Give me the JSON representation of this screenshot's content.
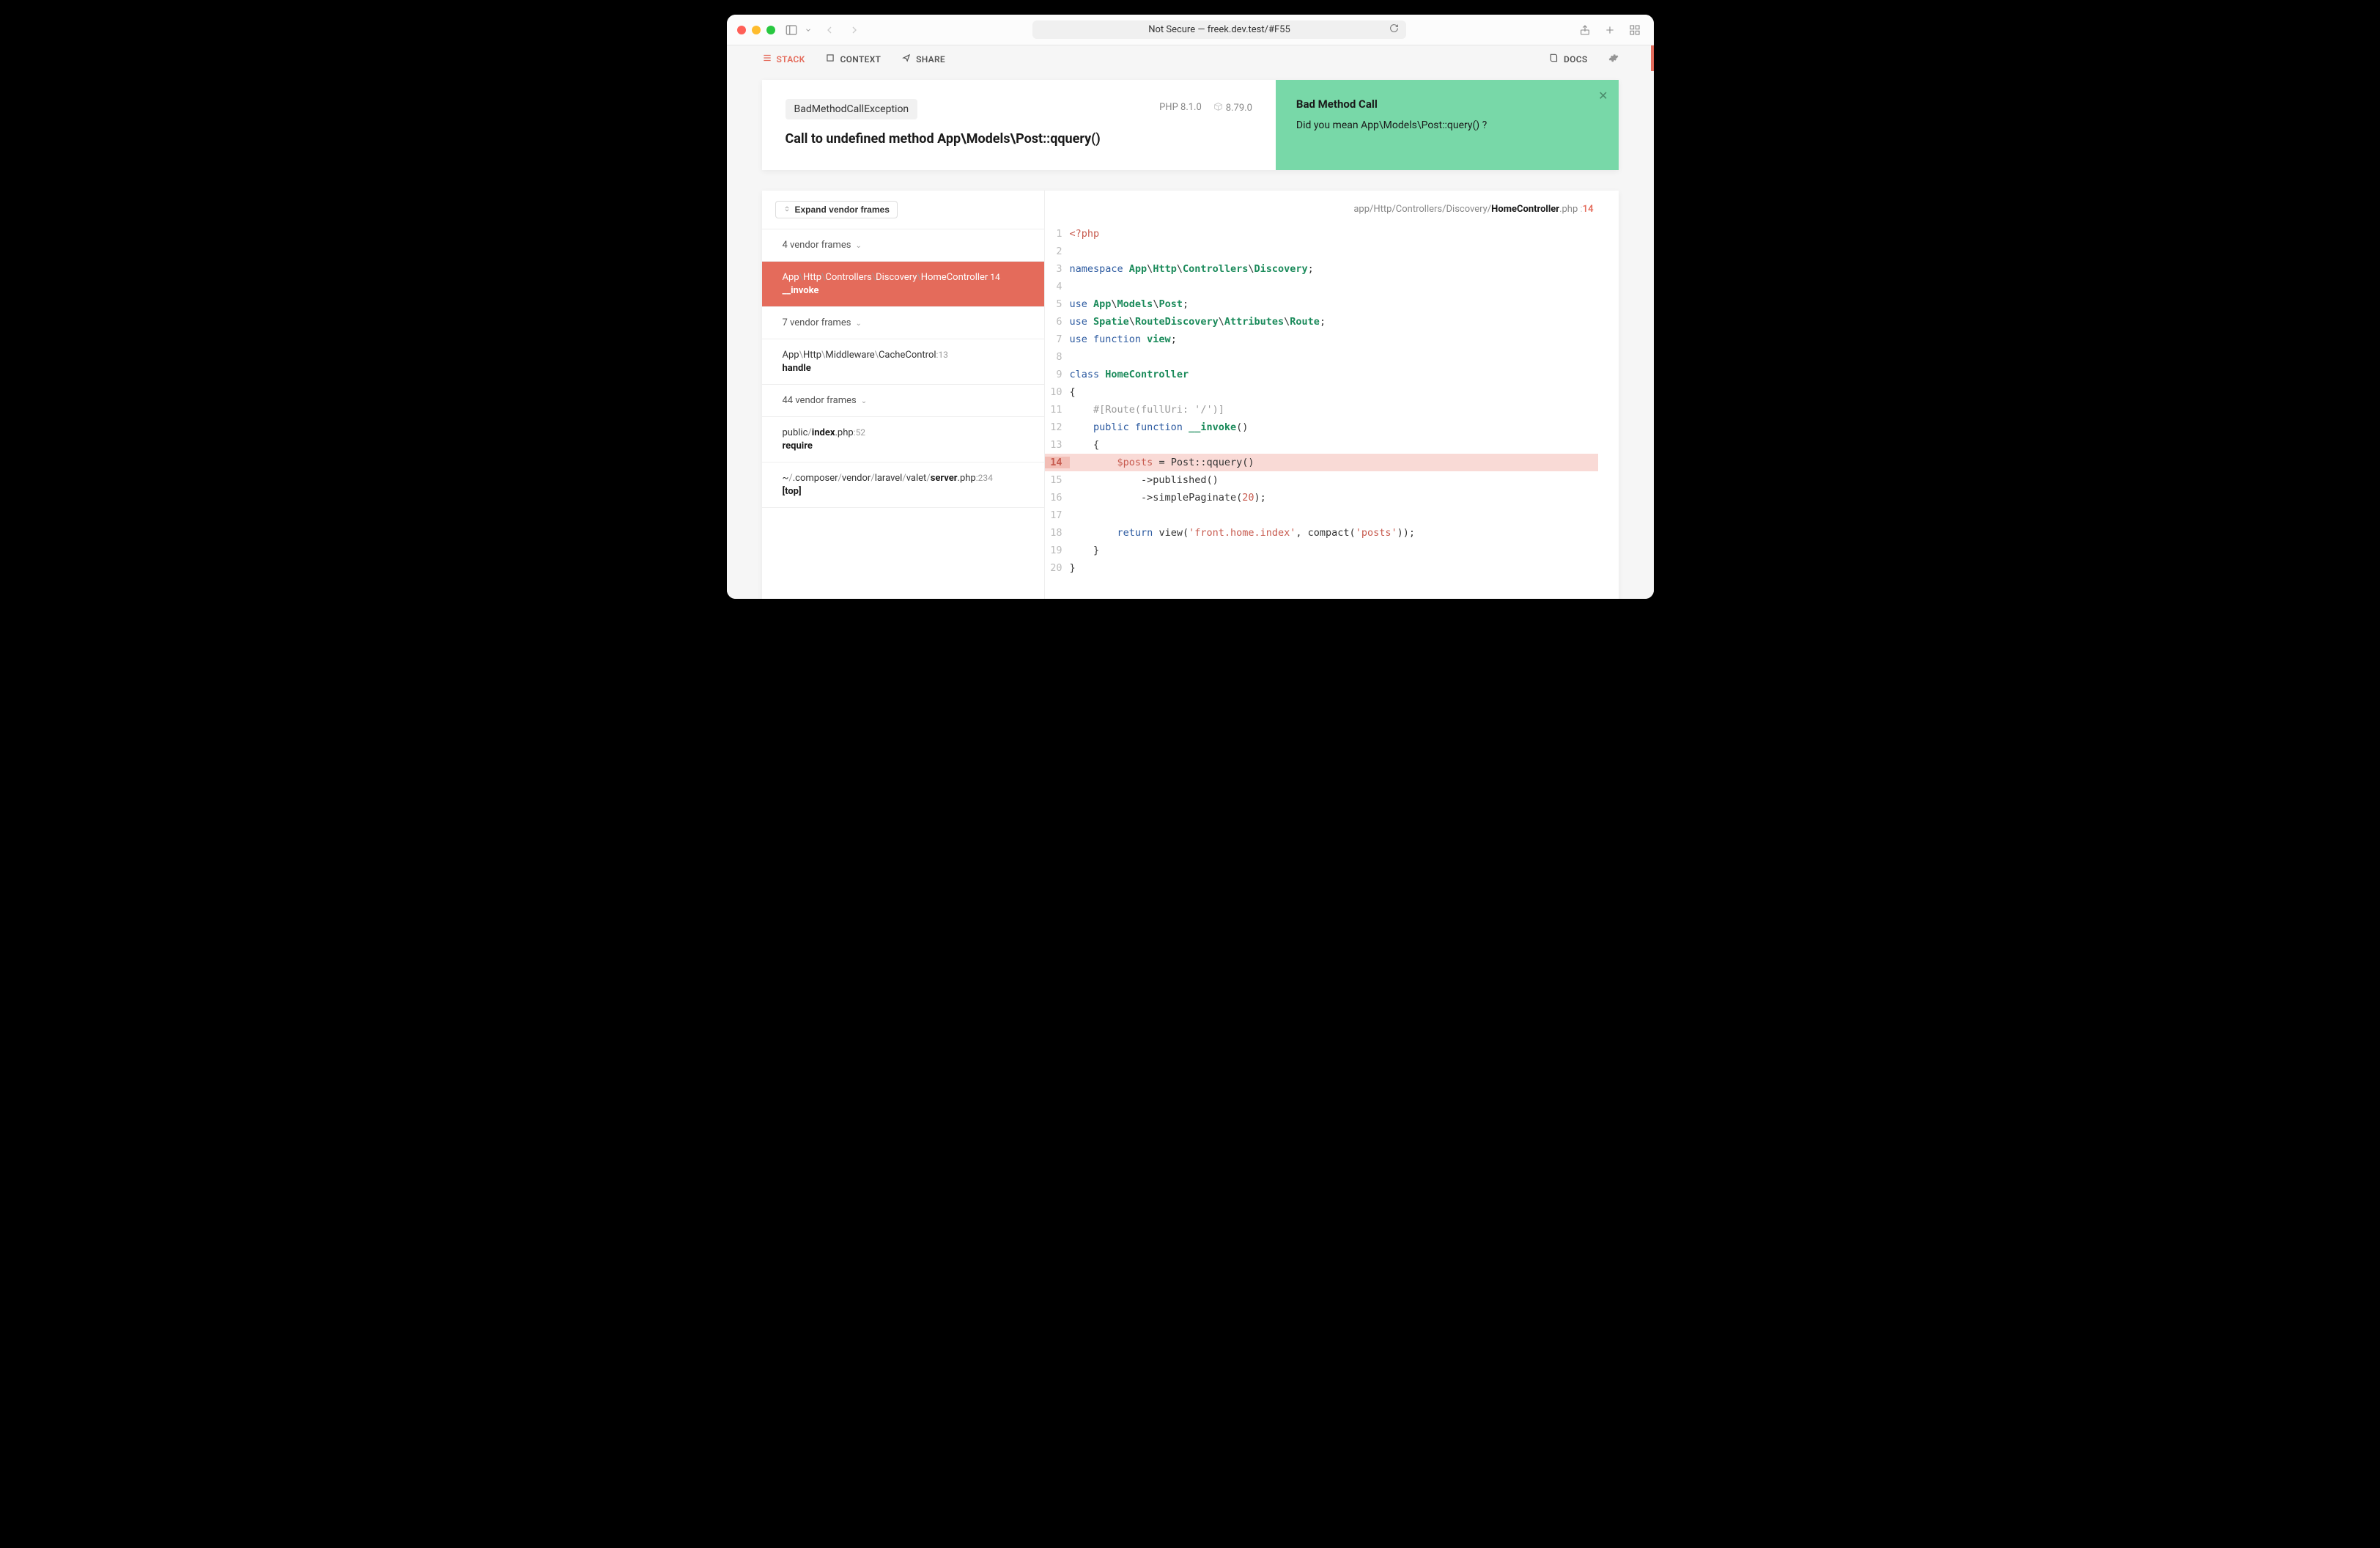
{
  "browser": {
    "address": "Not Secure — freek.dev.test/#F55"
  },
  "nav": {
    "stack": "STACK",
    "context": "CONTEXT",
    "share": "SHARE",
    "docs": "DOCS"
  },
  "error": {
    "exception": "BadMethodCallException",
    "message": "Call to undefined method App\\Models\\Post::qquery()",
    "php_label": "PHP 8.1.0",
    "laravel_label": "8.79.0"
  },
  "solution": {
    "title": "Bad Method Call",
    "body": "Did you mean App\\Models\\Post::query() ?"
  },
  "frames": {
    "expand": "Expand vendor frames",
    "items": [
      {
        "label": "4 vendor frames",
        "type": "vendor"
      },
      {
        "title": "App\\Http\\Controllers\\Discovery\\HomeController",
        "line": 14,
        "method": "__invoke",
        "selected": true,
        "type": "frame"
      },
      {
        "label": "7 vendor frames",
        "type": "vendor"
      },
      {
        "title": "App\\Http\\Middleware\\CacheControl",
        "line": 13,
        "method": "handle",
        "type": "frame"
      },
      {
        "label": "44 vendor frames",
        "type": "vendor"
      },
      {
        "path": [
          {
            "t": "public",
            "b": false
          },
          {
            "t": "index",
            "b": true
          },
          {
            "t": ".php",
            "b": false
          }
        ],
        "line": 52,
        "method": "require",
        "type": "file"
      },
      {
        "path": [
          {
            "t": "~",
            "b": false
          },
          {
            "t": ".composer",
            "b": false
          },
          {
            "t": "vendor",
            "b": false
          },
          {
            "t": "laravel",
            "b": false
          },
          {
            "t": "valet",
            "b": false
          },
          {
            "t": "server",
            "b": true
          },
          {
            "t": ".php",
            "b": false
          }
        ],
        "line": 234,
        "method": "[top]",
        "type": "file"
      }
    ]
  },
  "code": {
    "file_path_plain": "app/Http/Controllers/Discovery/",
    "file_path_bold": "HomeController",
    "file_path_ext": ".php",
    "file_line": 14,
    "start_line": 1,
    "highlight": 14,
    "lines": [
      [
        {
          "c": "tok-php",
          "t": "<?php"
        }
      ],
      [],
      [
        {
          "c": "tok-kw",
          "t": "namespace "
        },
        {
          "c": "tok-ns",
          "t": "App"
        },
        {
          "c": "",
          "t": "\\"
        },
        {
          "c": "tok-ns",
          "t": "Http"
        },
        {
          "c": "",
          "t": "\\"
        },
        {
          "c": "tok-ns",
          "t": "Controllers"
        },
        {
          "c": "",
          "t": "\\"
        },
        {
          "c": "tok-ns",
          "t": "Discovery"
        },
        {
          "c": "",
          "t": ";"
        }
      ],
      [],
      [
        {
          "c": "tok-kw",
          "t": "use "
        },
        {
          "c": "tok-ns",
          "t": "App"
        },
        {
          "c": "",
          "t": "\\"
        },
        {
          "c": "tok-ns",
          "t": "Models"
        },
        {
          "c": "",
          "t": "\\"
        },
        {
          "c": "tok-ns",
          "t": "Post"
        },
        {
          "c": "",
          "t": ";"
        }
      ],
      [
        {
          "c": "tok-kw",
          "t": "use "
        },
        {
          "c": "tok-ns",
          "t": "Spatie"
        },
        {
          "c": "",
          "t": "\\"
        },
        {
          "c": "tok-ns",
          "t": "RouteDiscovery"
        },
        {
          "c": "",
          "t": "\\"
        },
        {
          "c": "tok-ns",
          "t": "Attributes"
        },
        {
          "c": "",
          "t": "\\"
        },
        {
          "c": "tok-ns",
          "t": "Route"
        },
        {
          "c": "",
          "t": ";"
        }
      ],
      [
        {
          "c": "tok-kw",
          "t": "use function "
        },
        {
          "c": "tok-id",
          "t": "view"
        },
        {
          "c": "",
          "t": ";"
        }
      ],
      [],
      [
        {
          "c": "tok-kw",
          "t": "class "
        },
        {
          "c": "tok-id",
          "t": "HomeController"
        }
      ],
      [
        {
          "c": "",
          "t": "{"
        }
      ],
      [
        {
          "c": "",
          "t": "    "
        },
        {
          "c": "tok-cmt",
          "t": "#[Route(fullUri: '/')]"
        }
      ],
      [
        {
          "c": "",
          "t": "    "
        },
        {
          "c": "tok-kw",
          "t": "public function "
        },
        {
          "c": "tok-fn",
          "t": "__invoke"
        },
        {
          "c": "",
          "t": "()"
        }
      ],
      [
        {
          "c": "",
          "t": "    {"
        }
      ],
      [
        {
          "c": "",
          "t": "        "
        },
        {
          "c": "tok-var",
          "t": "$posts"
        },
        {
          "c": "",
          "t": " = Post::"
        },
        {
          "c": "",
          "t": "qquery"
        },
        {
          "c": "",
          "t": "()"
        }
      ],
      [
        {
          "c": "",
          "t": "            ->"
        },
        {
          "c": "",
          "t": "published"
        },
        {
          "c": "",
          "t": "()"
        }
      ],
      [
        {
          "c": "",
          "t": "            ->"
        },
        {
          "c": "",
          "t": "simplePaginate"
        },
        {
          "c": "",
          "t": "("
        },
        {
          "c": "tok-num",
          "t": "20"
        },
        {
          "c": "",
          "t": ");"
        }
      ],
      [],
      [
        {
          "c": "",
          "t": "        "
        },
        {
          "c": "tok-kw",
          "t": "return"
        },
        {
          "c": "",
          "t": " view("
        },
        {
          "c": "tok-str",
          "t": "'front.home.index'"
        },
        {
          "c": "",
          "t": ", compact("
        },
        {
          "c": "tok-str",
          "t": "'posts'"
        },
        {
          "c": "",
          "t": "));"
        }
      ],
      [
        {
          "c": "",
          "t": "    }"
        }
      ],
      [
        {
          "c": "",
          "t": "}"
        }
      ]
    ]
  }
}
